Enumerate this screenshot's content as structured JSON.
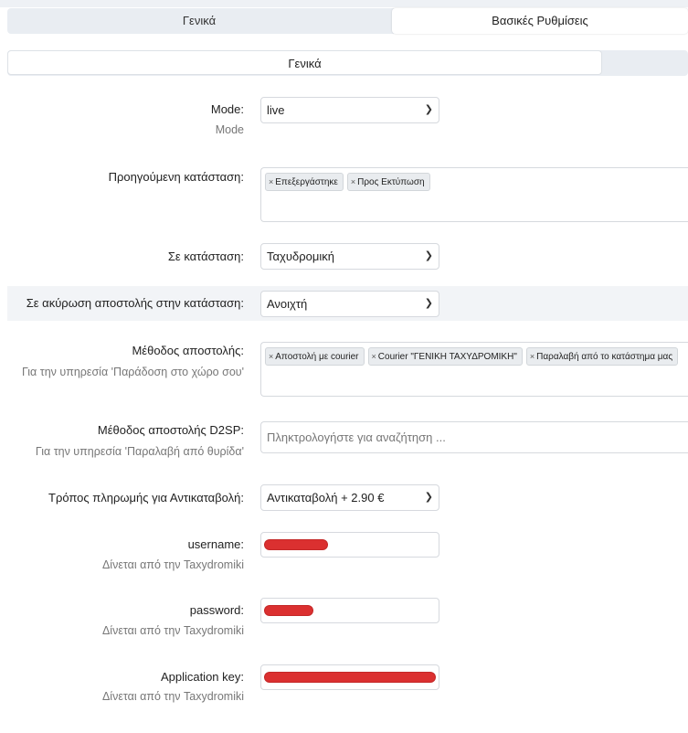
{
  "tabs": [
    "Γενικά",
    "Βασικές Ρυθμίσεις"
  ],
  "subtab": "Γενικά",
  "fields": {
    "mode": {
      "label": "Mode:",
      "hint": "Mode",
      "value": "live"
    },
    "prev_status": {
      "label": "Προηγούμενη κατάσταση:",
      "chips": [
        "Επεξεργάστηκε",
        "Προς Εκτύπωση"
      ]
    },
    "to_status": {
      "label": "Σε κατάσταση:",
      "value": "Ταχυδρομική"
    },
    "cancel_status": {
      "label": "Σε ακύρωση αποστολής στην κατάσταση:",
      "value": "Ανοιχτή"
    },
    "ship_method": {
      "label": "Μέθοδος αποστολής:",
      "hint": "Για την υπηρεσία 'Παράδοση στο χώρο σου'",
      "chips": [
        "Αποστολή με courier",
        "Courier \"ΓΕΝΙΚΗ ΤΑΧΥΔΡΟΜΙΚΗ\"",
        "Παραλαβή από το κατάστημα μας"
      ]
    },
    "d2sp": {
      "label": "Μέθοδος αποστολής D2SP:",
      "hint": "Για την υπηρεσία 'Παραλαβή από θυρίδα'",
      "placeholder": "Πληκτρολογήστε για αναζήτηση ..."
    },
    "payment": {
      "label": "Τρόπος πληρωμής για Αντικαταβολή:",
      "value": "Αντικαταβολή + 2.90 €"
    },
    "username": {
      "label": "username:",
      "hint": "Δίνεται από την Taxydromiki"
    },
    "password": {
      "label": "password:",
      "hint": "Δίνεται από την Taxydromiki"
    },
    "appkey": {
      "label": "Application key:",
      "hint": "Δίνεται από την Taxydromiki"
    }
  },
  "icons": {
    "chevron": "chevron-down-icon",
    "chip_remove": "close-icon"
  },
  "colors": {
    "redaction": "#d81f1f",
    "shaded_row": "#f2f4f7"
  }
}
